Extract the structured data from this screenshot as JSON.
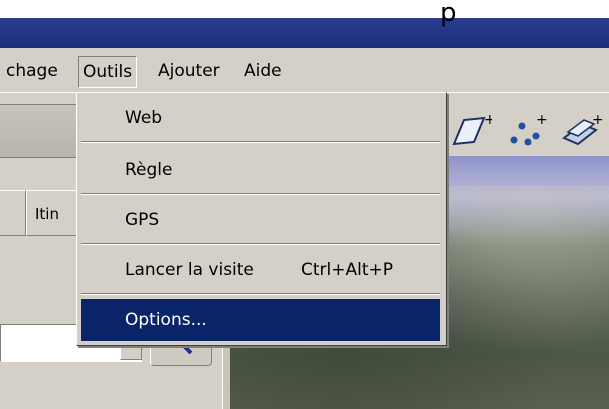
{
  "window": {
    "title_fragment": "p"
  },
  "menubar": {
    "items": [
      {
        "label": "chage"
      },
      {
        "label": "Outils"
      },
      {
        "label": "Ajouter"
      },
      {
        "label": "Aide"
      }
    ]
  },
  "dropdown": {
    "items": [
      {
        "label": "Web"
      },
      {
        "label": "Règle"
      },
      {
        "label": "GPS"
      },
      {
        "label": "Lancer la visite",
        "shortcut": "Ctrl+Alt+P"
      },
      {
        "label": "Options..."
      }
    ],
    "selected": "Options..."
  },
  "left_panel": {
    "tabs": [
      {
        "label": ""
      },
      {
        "label": "Itin"
      }
    ]
  },
  "toolbar_icons": [
    "add-polygon-icon",
    "add-path-icon",
    "add-overlay-icon"
  ],
  "colors": {
    "titlebar": "#1c2d7a",
    "menu_bg": "#d4d0c8",
    "selection": "#0a246a"
  }
}
